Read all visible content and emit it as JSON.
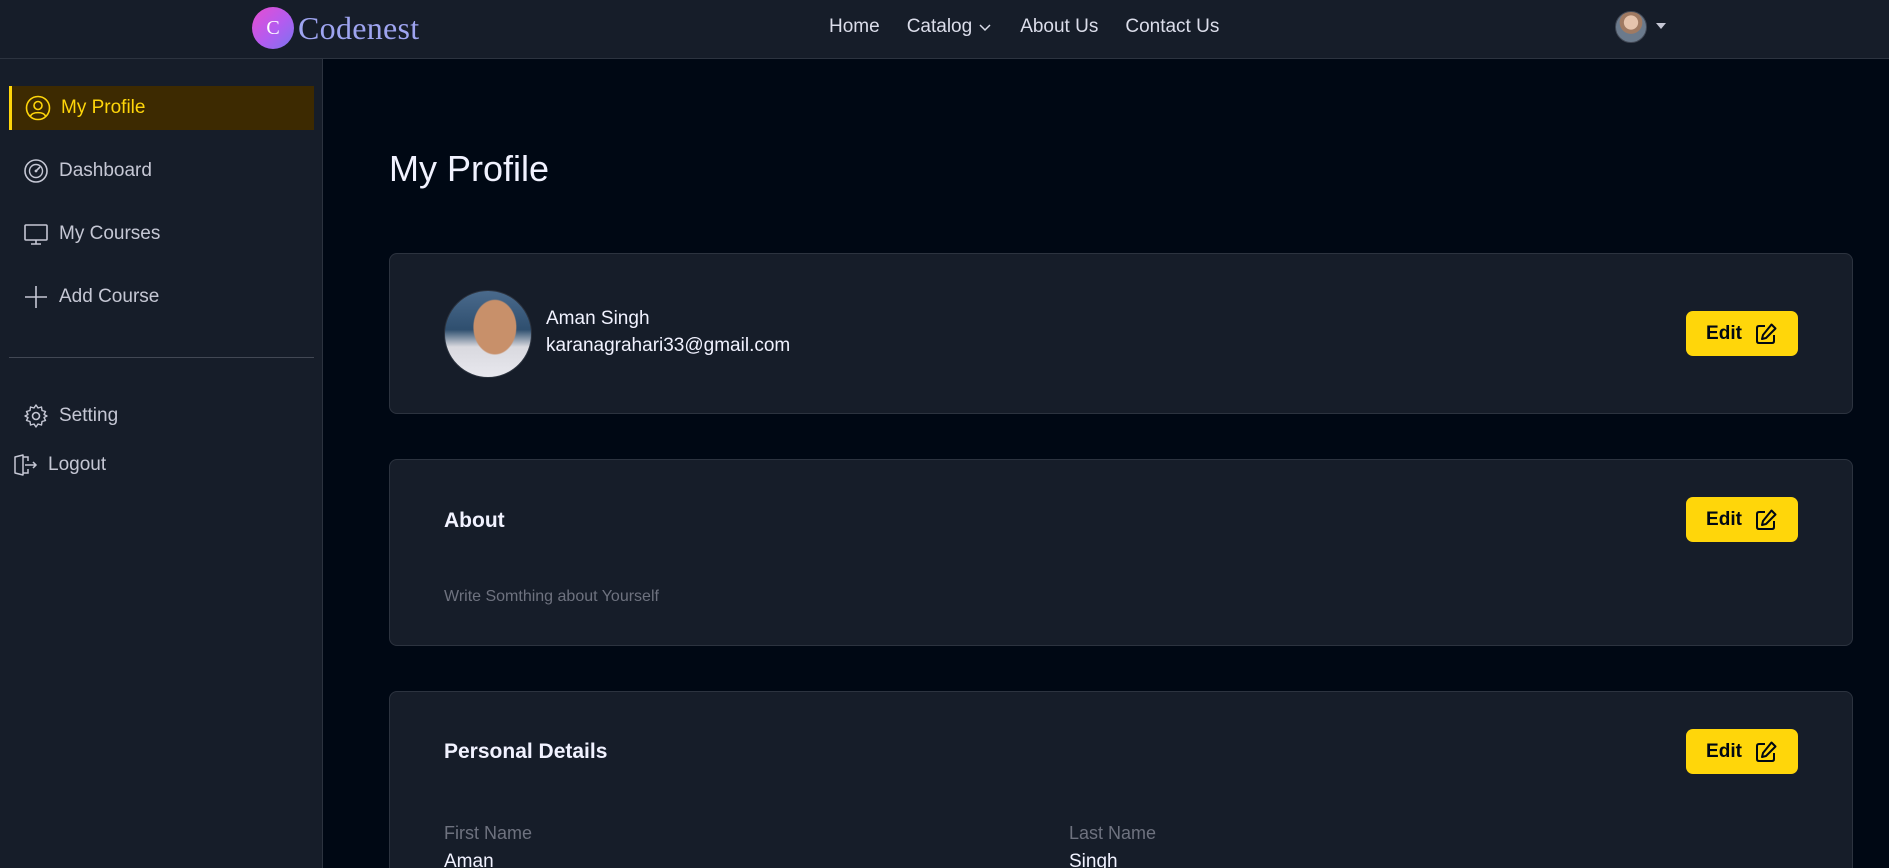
{
  "brand": {
    "logo_letter": "C",
    "name": "Codenest"
  },
  "nav": {
    "links": [
      {
        "label": "Home"
      },
      {
        "label": "Catalog"
      },
      {
        "label": "About Us"
      },
      {
        "label": "Contact Us"
      }
    ]
  },
  "sidebar": {
    "items": [
      {
        "label": "My Profile",
        "icon": "user-circle-icon",
        "active": true
      },
      {
        "label": "Dashboard",
        "icon": "gauge-icon"
      },
      {
        "label": "My Courses",
        "icon": "monitor-icon"
      },
      {
        "label": "Add Course",
        "icon": "plus-icon"
      }
    ],
    "bottom_items": [
      {
        "label": "Setting",
        "icon": "gear-icon"
      },
      {
        "label": "Logout",
        "icon": "logout-icon"
      }
    ]
  },
  "page": {
    "title": "My Profile"
  },
  "profile": {
    "name": "Aman Singh",
    "email": "karanagrahari33@gmail.com",
    "edit_label": "Edit"
  },
  "about": {
    "title": "About",
    "text": "Write Somthing about Yourself",
    "edit_label": "Edit"
  },
  "personal_details": {
    "title": "Personal Details",
    "edit_label": "Edit",
    "fields": [
      {
        "label": "First Name",
        "value": "Aman"
      },
      {
        "label": "Last Name",
        "value": "Singh"
      }
    ]
  },
  "colors": {
    "accent": "#ffd60a",
    "background": "#000814",
    "panel": "#161d29",
    "active_bg": "#3d2a01"
  }
}
